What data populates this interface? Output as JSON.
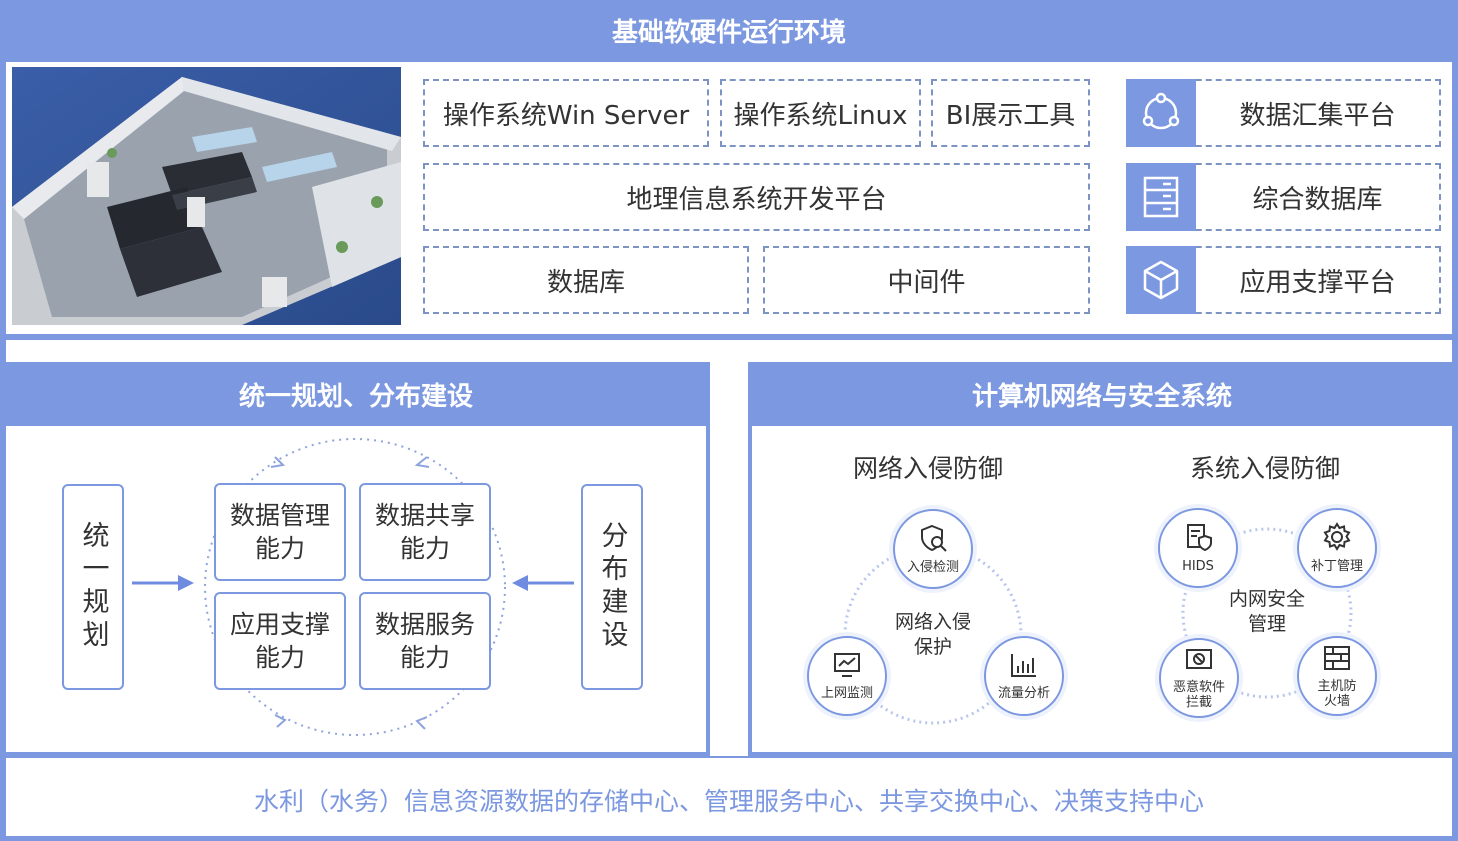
{
  "top": {
    "title": "基础软硬件运行环境",
    "row1": [
      "操作系统Win Server",
      "操作系统Linux",
      "BI展示工具"
    ],
    "row2": "地理信息系统开发平台",
    "row3": [
      "数据库",
      "中间件"
    ],
    "platforms": [
      {
        "label": "数据汇集平台",
        "icon": "share-network-icon"
      },
      {
        "label": "综合数据库",
        "icon": "server-rack-icon"
      },
      {
        "label": "应用支撑平台",
        "icon": "cube-icon"
      }
    ]
  },
  "left": {
    "title": "统一规划、分布建设",
    "side_left": "统一规划",
    "side_right": "分布建设",
    "capabilities": [
      "数据管理能力",
      "数据共享能力",
      "应用支撑能力",
      "数据服务能力"
    ]
  },
  "right": {
    "title": "计算机网络与安全系统",
    "group1": {
      "title": "网络入侵防御",
      "center": "网络入侵保护",
      "nodes": [
        {
          "label": "入侵检测",
          "icon": "shield-search-icon"
        },
        {
          "label": "上网监测",
          "icon": "monitor-chart-icon"
        },
        {
          "label": "流量分析",
          "icon": "bar-chart-icon"
        }
      ]
    },
    "group2": {
      "title": "系统入侵防御",
      "center": "内网安全管理",
      "nodes": [
        {
          "label": "HIDS",
          "icon": "server-shield-icon"
        },
        {
          "label": "补丁管理",
          "icon": "gear-icon"
        },
        {
          "label": "恶意软件拦截",
          "icon": "block-screen-icon"
        },
        {
          "label": "主机防火墙",
          "icon": "firewall-icon"
        }
      ]
    }
  },
  "bottom": "水利（水务）信息资源数据的存储中心、管理服务中心、共享交换中心、决策支持中心",
  "colors": {
    "accent": "#7c98e0",
    "border": "#7d93c4",
    "text": "#333333"
  }
}
